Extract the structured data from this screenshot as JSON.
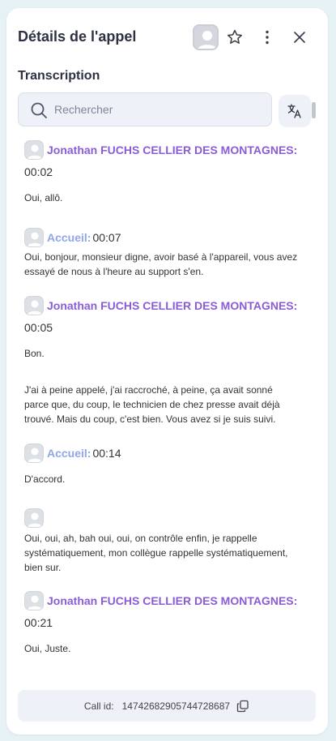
{
  "header": {
    "title": "Détails de l'appel"
  },
  "transcription": {
    "title": "Transcription",
    "search_placeholder": "Rechercher",
    "messages": [
      {
        "speaker": "Jonathan FUCHS CELLIER DES MONTAGNES:",
        "time": "00:02",
        "text": "Oui, allô."
      },
      {
        "speaker": "Accueil:",
        "time": "00:07",
        "text": "Oui, bonjour, monsieur digne, avoir basé à l'appareil, vous avez essayé de nous à l'heure au support s'en."
      },
      {
        "speaker": "Jonathan FUCHS CELLIER DES MONTAGNES:",
        "time": "00:05",
        "text": "Bon."
      },
      {
        "text": "J'ai à peine appelé, j'ai raccroché, à peine, ça avait sonné parce que, du coup, le technicien de chez presse avait déjà trouvé. Mais du coup, c'est bien. Vous avez si je suis suivi."
      },
      {
        "speaker": "Accueil:",
        "time": "00:14",
        "text": "D'accord."
      },
      {
        "text": "Oui, oui, ah, bah oui, oui, on contrôle enfin, je rappelle systématiquement, mon collègue rappelle systématiquement, bien sur."
      },
      {
        "speaker": "Jonathan FUCHS CELLIER DES MONTAGNES:",
        "time": "00:21",
        "text": "Oui, Juste."
      }
    ]
  },
  "footer": {
    "call_id_label": "Call id:",
    "call_id_value": "14742682905744728687"
  },
  "colors": {
    "speaker_primary": "#8a5cd6",
    "speaker_secondary": "#8fa7e8",
    "page_background": "#e6f2f6"
  },
  "icons": [
    "person-icon",
    "star-icon",
    "more-vertical-icon",
    "close-icon",
    "search-icon",
    "translate-icon",
    "copy-icon"
  ]
}
